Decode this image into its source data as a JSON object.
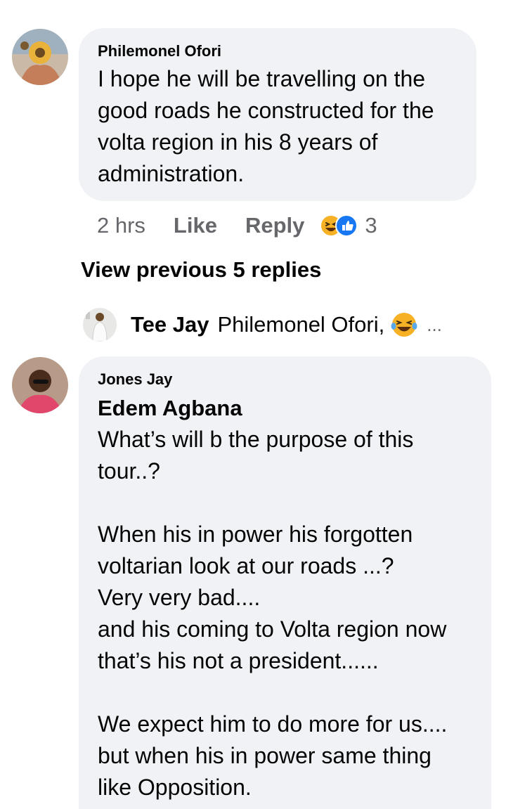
{
  "comment1": {
    "author": "Philemonel Ofori",
    "text": "I hope he will be travelling on the\ngood roads he constructed for the\nvolta region in his 8 years of\nadministration.",
    "time": "2 hrs",
    "like_label": "Like",
    "reply_label": "Reply",
    "reaction_icons": [
      "laugh-reaction-icon",
      "like-reaction-icon"
    ],
    "reaction_count": "3"
  },
  "view_previous_replies": "View previous 5 replies",
  "reply_preview": {
    "author": "Tee Jay",
    "text": "Philemonel Ofori,",
    "emoji": "tears-of-joy-emoji",
    "more": "..."
  },
  "comment2": {
    "author": "Jones Jay",
    "tagged_name": "Edem Agbana",
    "text": "What’s will b the purpose of this\ntour..?\n\nWhen his in power his forgotten\nvoltarian look at our roads ...?\nVery very bad....\nand his coming to Volta region now\nthat’s his not a president......\n\nWe expect him to do more for us....\nbut when his in power same thing\nlike Opposition."
  },
  "colors": {
    "bubble_bg": "#f0f2f5",
    "meta_text": "#65676b",
    "like_blue": "#1877f2",
    "emoji_yellow": "#f7b125"
  }
}
